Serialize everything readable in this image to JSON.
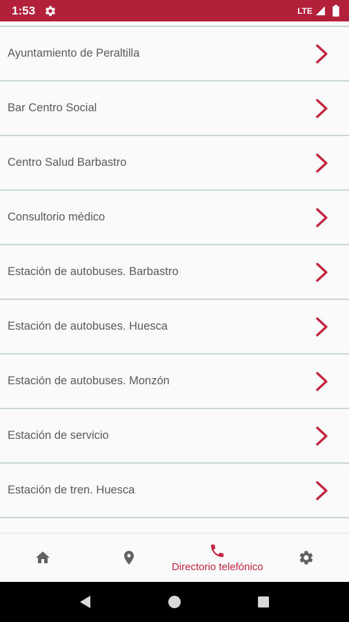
{
  "status_bar": {
    "time": "1:53",
    "network": "LTE",
    "icons": [
      "gear-icon",
      "signal-icon",
      "battery-icon"
    ]
  },
  "list": {
    "items": [
      {
        "label": "Ayuntamiento de Peraltilla"
      },
      {
        "label": "Bar Centro Social"
      },
      {
        "label": "Centro Salud Barbastro"
      },
      {
        "label": "Consultorio médico"
      },
      {
        "label": "Estación de autobuses. Barbastro"
      },
      {
        "label": "Estación de autobuses. Huesca"
      },
      {
        "label": "Estación de autobuses. Monzón"
      },
      {
        "label": "Estación de servicio"
      },
      {
        "label": "Estación de tren. Huesca"
      }
    ],
    "chevron_icon": "chevron-right-icon"
  },
  "bottom_nav": {
    "items": [
      {
        "icon": "home-icon",
        "label": "",
        "active": false
      },
      {
        "icon": "location-pin-icon",
        "label": "",
        "active": false
      },
      {
        "icon": "phone-icon",
        "label": "Directorio telefónico",
        "active": true
      },
      {
        "icon": "gear-icon",
        "label": "",
        "active": false
      }
    ]
  },
  "system_nav": {
    "buttons": [
      "back-icon",
      "home-circle-icon",
      "recents-square-icon"
    ]
  },
  "colors": {
    "accent": "#c3243f",
    "status_bar": "#b3203a",
    "divider": "#c8d6d9",
    "inactive_icon": "#616161",
    "text": "#5a5a5a"
  }
}
